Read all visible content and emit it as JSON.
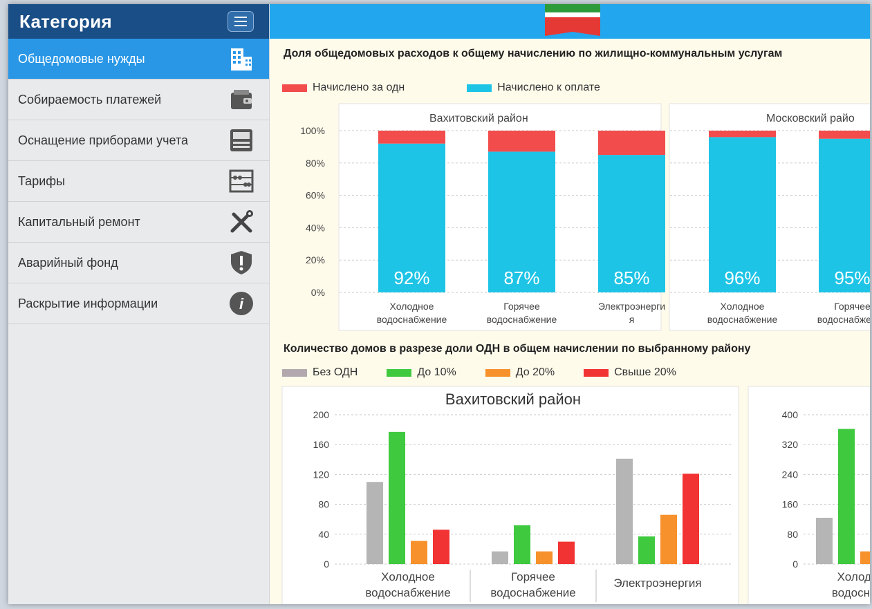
{
  "sidebar": {
    "title": "Категория",
    "items": [
      {
        "label": "Общедомовые нужды",
        "icon": "building-icon",
        "active": true
      },
      {
        "label": "Собираемость платежей",
        "icon": "wallet-icon"
      },
      {
        "label": "Оснащение приборами учета",
        "icon": "meter-icon"
      },
      {
        "label": "Тарифы",
        "icon": "abacus-icon"
      },
      {
        "label": "Капитальный ремонт",
        "icon": "tools-icon"
      },
      {
        "label": "Аварийный фонд",
        "icon": "shield-warning-icon"
      },
      {
        "label": "Раскрытие информации",
        "icon": "info-icon"
      }
    ]
  },
  "main": {
    "title1": "Доля общедомовых расходов к общему начислению по жилищно-коммунальным услугам",
    "title2": "Количество домов в разрезе доли ОДН в общем начислении по выбранному району"
  },
  "colors": {
    "odn": "#f24c4c",
    "payment": "#1ec4e6",
    "none": "#b5b5b5",
    "to10": "#3fc93f",
    "to20": "#f7912b",
    "over20": "#f23333"
  },
  "chart_data": [
    {
      "type": "bar",
      "stacked": true,
      "legend": [
        "Начислено за одн",
        "Начислено к оплате"
      ],
      "yticks": [
        "100%",
        "80%",
        "60%",
        "40%",
        "20%",
        "0%"
      ],
      "ylim": [
        0,
        100
      ],
      "panels": [
        {
          "title": "Вахитовский район",
          "categories": [
            [
              "Холодное",
              "водоснабжение"
            ],
            [
              "Горячее",
              "водоснабжение"
            ],
            [
              "Электроэнерги",
              "я"
            ]
          ],
          "series": [
            {
              "name": "Начислено к оплате",
              "values": [
                92,
                87,
                85
              ]
            },
            {
              "name": "Начислено за одн",
              "values": [
                8,
                13,
                15
              ]
            }
          ],
          "labels": [
            "92%",
            "87%",
            "85%"
          ]
        },
        {
          "title": "Московский райо",
          "categories": [
            [
              "Холодное",
              "водоснабжение"
            ],
            [
              "Горячее",
              "водоснабжение"
            ]
          ],
          "series": [
            {
              "name": "Начислено к оплате",
              "values": [
                96,
                95
              ]
            },
            {
              "name": "Начислено за одн",
              "values": [
                4,
                5
              ]
            }
          ],
          "labels": [
            "96%",
            "95%"
          ]
        }
      ]
    },
    {
      "type": "bar",
      "legend": [
        "Без ОДН",
        "До 10%",
        "До 20%",
        "Свыше 20%"
      ],
      "panels": [
        {
          "title": "Вахитовский район",
          "ylim": [
            0,
            200
          ],
          "yticks": [
            "200",
            "160",
            "120",
            "80",
            "40",
            "0"
          ],
          "categories": [
            [
              "Холодное",
              "водоснабжение"
            ],
            [
              "Горячее",
              "водоснабжение"
            ],
            [
              "Электроэнергия"
            ]
          ],
          "series": [
            {
              "name": "Без ОДН",
              "values": [
                110,
                17,
                141
              ]
            },
            {
              "name": "До 10%",
              "values": [
                177,
                52,
                37
              ]
            },
            {
              "name": "До 20%",
              "values": [
                31,
                17,
                66
              ]
            },
            {
              "name": "Свыше 20%",
              "values": [
                46,
                30,
                121
              ]
            }
          ]
        },
        {
          "title": "",
          "ylim": [
            0,
            400
          ],
          "yticks": [
            "400",
            "320",
            "240",
            "160",
            "80",
            "0"
          ],
          "categories": [
            [
              "Холодн",
              "водоснаб"
            ]
          ],
          "series": [
            {
              "name": "Без ОДН",
              "values": [
                124
              ]
            },
            {
              "name": "До 10%",
              "values": [
                362
              ]
            },
            {
              "name": "До 20%",
              "values": [
                34
              ]
            }
          ]
        }
      ]
    }
  ]
}
